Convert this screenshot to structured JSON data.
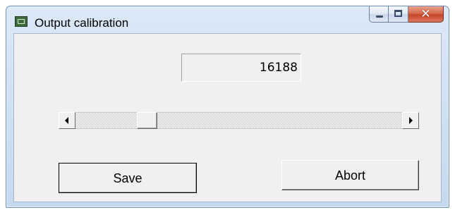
{
  "window": {
    "title": "Output calibration",
    "icon": "app-icon",
    "caption_buttons": [
      "minimize-icon",
      "maximize-icon",
      "close-icon"
    ]
  },
  "value_display": {
    "value": "16188"
  },
  "slider": {
    "position_fraction": 0.2,
    "left_arrow": "arrow-left-icon",
    "right_arrow": "arrow-right-icon"
  },
  "buttons": {
    "save_label": "Save",
    "abort_label": "Abort"
  }
}
